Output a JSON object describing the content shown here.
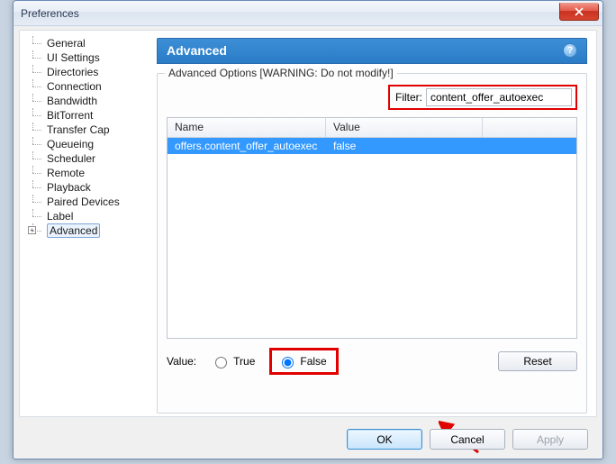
{
  "window": {
    "title": "Preferences"
  },
  "tree": {
    "items": [
      "General",
      "UI Settings",
      "Directories",
      "Connection",
      "Bandwidth",
      "BitTorrent",
      "Transfer Cap",
      "Queueing",
      "Scheduler",
      "Remote",
      "Playback",
      "Paired Devices",
      "Label",
      "Advanced"
    ]
  },
  "section": {
    "title": "Advanced",
    "group_legend": "Advanced Options [WARNING: Do not modify!]"
  },
  "filter": {
    "label": "Filter:",
    "value": "content_offer_autoexec"
  },
  "table": {
    "columns": {
      "name": "Name",
      "value": "Value"
    },
    "rows": [
      {
        "name": "offers.content_offer_autoexec",
        "value": "false"
      }
    ]
  },
  "value_row": {
    "label": "Value:",
    "true_label": "True",
    "false_label": "False",
    "reset_label": "Reset",
    "selected": "false"
  },
  "buttons": {
    "ok": "OK",
    "cancel": "Cancel",
    "apply": "Apply"
  }
}
